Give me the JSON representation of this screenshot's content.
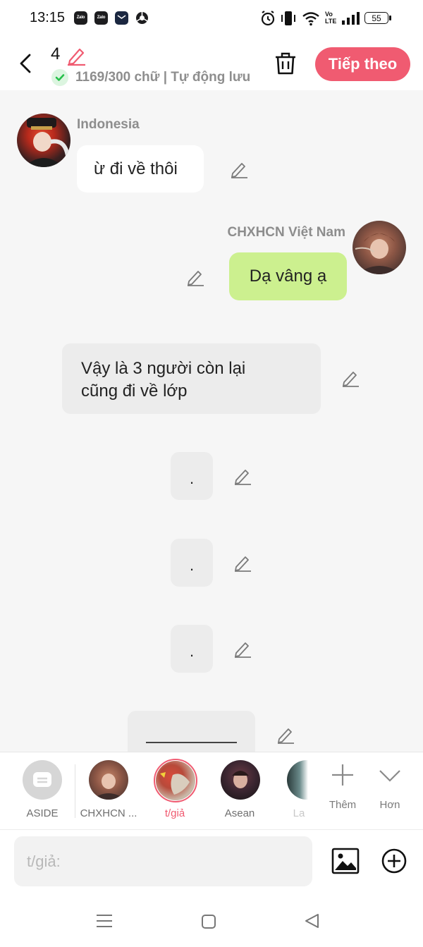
{
  "status_bar": {
    "time": "13:15",
    "app_icons": [
      "Zalo",
      "Zalo",
      "mail-icon",
      "chrome-icon"
    ],
    "battery": "55"
  },
  "header": {
    "chapter_number": "4",
    "word_status": "1169/300 chữ | Tự động lưu",
    "next_label": "Tiếp theo",
    "accent_color": "#f05b71"
  },
  "messages": [
    {
      "type": "left",
      "speaker": "Indonesia",
      "text": "ừ đi về thôi"
    },
    {
      "type": "right",
      "speaker": "CHXHCN Việt Nam",
      "text": "Dạ vâng ạ",
      "bubble_color": "#ccf08f"
    },
    {
      "type": "narration",
      "text_line1": "Vậy là 3 người còn lại",
      "text_line2": "cũng đi về lớp"
    },
    {
      "type": "narration",
      "text": "."
    },
    {
      "type": "narration",
      "text": "."
    },
    {
      "type": "narration",
      "text": "."
    },
    {
      "type": "divider",
      "text": ""
    }
  ],
  "characters": [
    {
      "label": "ASIDE",
      "selected": false
    },
    {
      "label": "CHXHCN ...",
      "selected": false
    },
    {
      "label": "t/giả",
      "selected": true
    },
    {
      "label": "Asean",
      "selected": false
    },
    {
      "label": "La",
      "selected": false
    }
  ],
  "char_actions": {
    "add_label": "Thêm",
    "more_label": "Hơn"
  },
  "input": {
    "placeholder": "t/giả:"
  }
}
